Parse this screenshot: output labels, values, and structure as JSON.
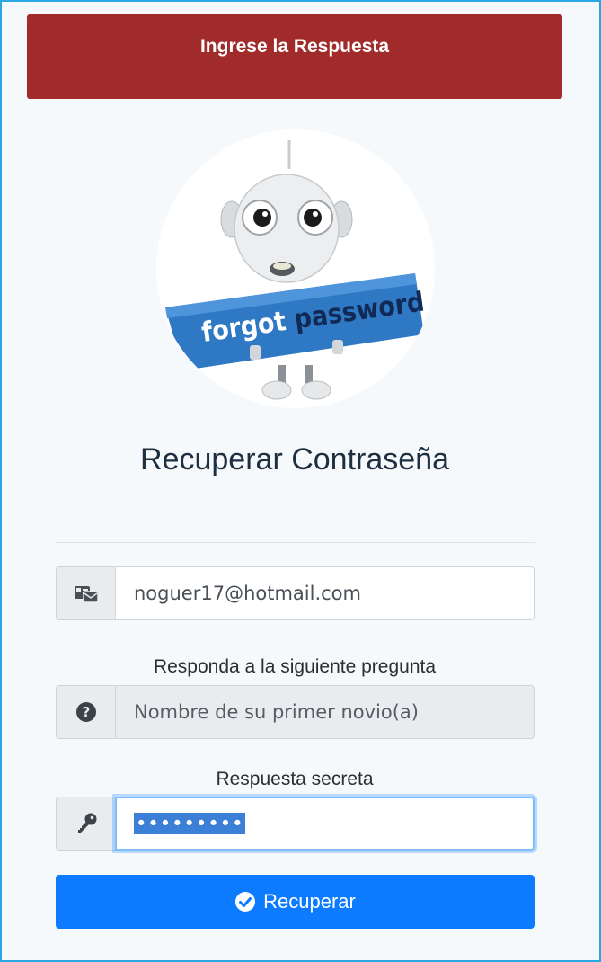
{
  "header": {
    "title": "Ingrese la Respuesta"
  },
  "illustration": {
    "sign_word1": "forgot",
    "sign_word2": "password"
  },
  "page_title": "Recuperar Contraseña",
  "email_field": {
    "value": "noguer17@hotmail.com",
    "icon": "id-card-icon"
  },
  "question": {
    "label": "Responda a la siguiente pregunta",
    "value": "Nombre de su primer novio(a)",
    "icon": "question-circle-icon"
  },
  "answer": {
    "label": "Respuesta secreta",
    "masked_value": "•••••••••",
    "icon": "key-icon"
  },
  "submit": {
    "label": "Recuperar",
    "icon": "check-circle-icon"
  },
  "colors": {
    "header_bg": "#a12a2a",
    "button_bg": "#0d7bff",
    "border_accent": "#2aa8e6"
  }
}
